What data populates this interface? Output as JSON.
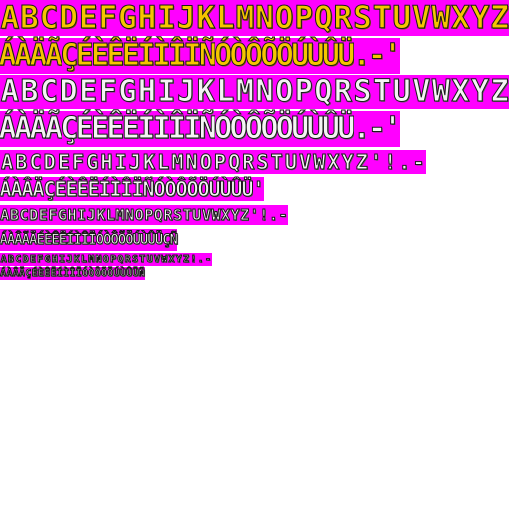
{
  "sheet": {
    "background_color": "#ffffff",
    "cell_color": "#ff00ff",
    "rows": [
      {
        "style": "gold",
        "glyphs": [
          "A",
          "B",
          "C",
          "D",
          "E",
          "F",
          "G",
          "H",
          "I",
          "J",
          "K",
          "L",
          "M",
          "N",
          "O",
          "P",
          "Q",
          "R",
          "S",
          "T",
          "U",
          "V",
          "W",
          "X",
          "Y",
          "Z"
        ]
      },
      {
        "style": "gold",
        "glyphs": [
          "Á",
          "À",
          "Ä",
          "Ã",
          "Ç",
          "É",
          "È",
          "Ê",
          "Ë",
          "Í",
          "Ì",
          "Î",
          "Ï",
          "Ñ",
          "Ó",
          "Ò",
          "Ô",
          "Õ",
          "Ö",
          "Ú",
          "Ù",
          "Û",
          "Ü",
          ".",
          "-",
          "'"
        ]
      },
      {
        "style": "silver",
        "glyphs": [
          "A",
          "B",
          "C",
          "D",
          "E",
          "F",
          "G",
          "H",
          "I",
          "J",
          "K",
          "L",
          "M",
          "N",
          "O",
          "P",
          "Q",
          "R",
          "S",
          "T",
          "U",
          "V",
          "W",
          "X",
          "Y",
          "Z"
        ]
      },
      {
        "style": "silver",
        "glyphs": [
          "Á",
          "À",
          "Ä",
          "Ã",
          "Ç",
          "É",
          "È",
          "Ê",
          "Ë",
          "Í",
          "Ì",
          "Î",
          "Ï",
          "Ñ",
          "Ó",
          "Ò",
          "Ô",
          "Õ",
          "Ö",
          "Ú",
          "Ù",
          "Û",
          "Ü",
          ".",
          "-",
          "'"
        ]
      },
      {
        "style": "silver",
        "glyphs": [
          "A",
          "B",
          "C",
          "D",
          "E",
          "F",
          "G",
          "H",
          "I",
          "J",
          "K",
          "L",
          "M",
          "N",
          "O",
          "P",
          "Q",
          "R",
          "S",
          "T",
          "U",
          "V",
          "W",
          "X",
          "Y",
          "Z",
          "'",
          "!",
          ".",
          "-"
        ]
      },
      {
        "style": "silver",
        "glyphs": [
          "Á",
          "À",
          "Â",
          "Ä",
          "Ç",
          "É",
          "È",
          "Ê",
          "Ë",
          "Í",
          "Ì",
          "Î",
          "Ï",
          "Ñ",
          "Ó",
          "Ò",
          "Ô",
          "Õ",
          "Ö",
          "Ú",
          "Ù",
          "Û",
          "Ü",
          "'"
        ]
      },
      {
        "style": "silver",
        "glyphs": [
          "A",
          "B",
          "C",
          "D",
          "E",
          "F",
          "G",
          "H",
          "I",
          "J",
          "K",
          "L",
          "M",
          "N",
          "O",
          "P",
          "Q",
          "R",
          "S",
          "T",
          "U",
          "V",
          "W",
          "X",
          "Y",
          "Z",
          "'",
          "!",
          ".",
          "-"
        ]
      },
      {
        "style": "silver",
        "glyphs": [
          "Á",
          "À",
          "Â",
          "Ã",
          "Ä",
          "É",
          "È",
          "Ê",
          "Ë",
          "Í",
          "Ì",
          "Î",
          "Ï",
          "Ó",
          "Ò",
          "Ô",
          "Õ",
          "Ö",
          "Ú",
          "Ù",
          "Û",
          "Ü",
          "Ç",
          "Ñ"
        ]
      },
      {
        "style": "silver",
        "glyphs": [
          "A",
          "B",
          "C",
          "D",
          "E",
          "F",
          "G",
          "H",
          "I",
          "J",
          "K",
          "L",
          "M",
          "N",
          "O",
          "P",
          "Q",
          "R",
          "S",
          "T",
          "U",
          "V",
          "W",
          "X",
          "Y",
          "Z",
          "!",
          ".",
          "-"
        ]
      },
      {
        "style": "silver",
        "glyphs": [
          "Á",
          "À",
          "Â",
          "Ä",
          "Ç",
          "É",
          "È",
          "Ê",
          "Ë",
          "Í",
          "Ì",
          "Î",
          "Ï",
          "Ó",
          "Ò",
          "Ô",
          "Õ",
          "Ö",
          "Ú",
          "Ù",
          "Û",
          "Ü",
          "Ñ"
        ]
      }
    ]
  }
}
